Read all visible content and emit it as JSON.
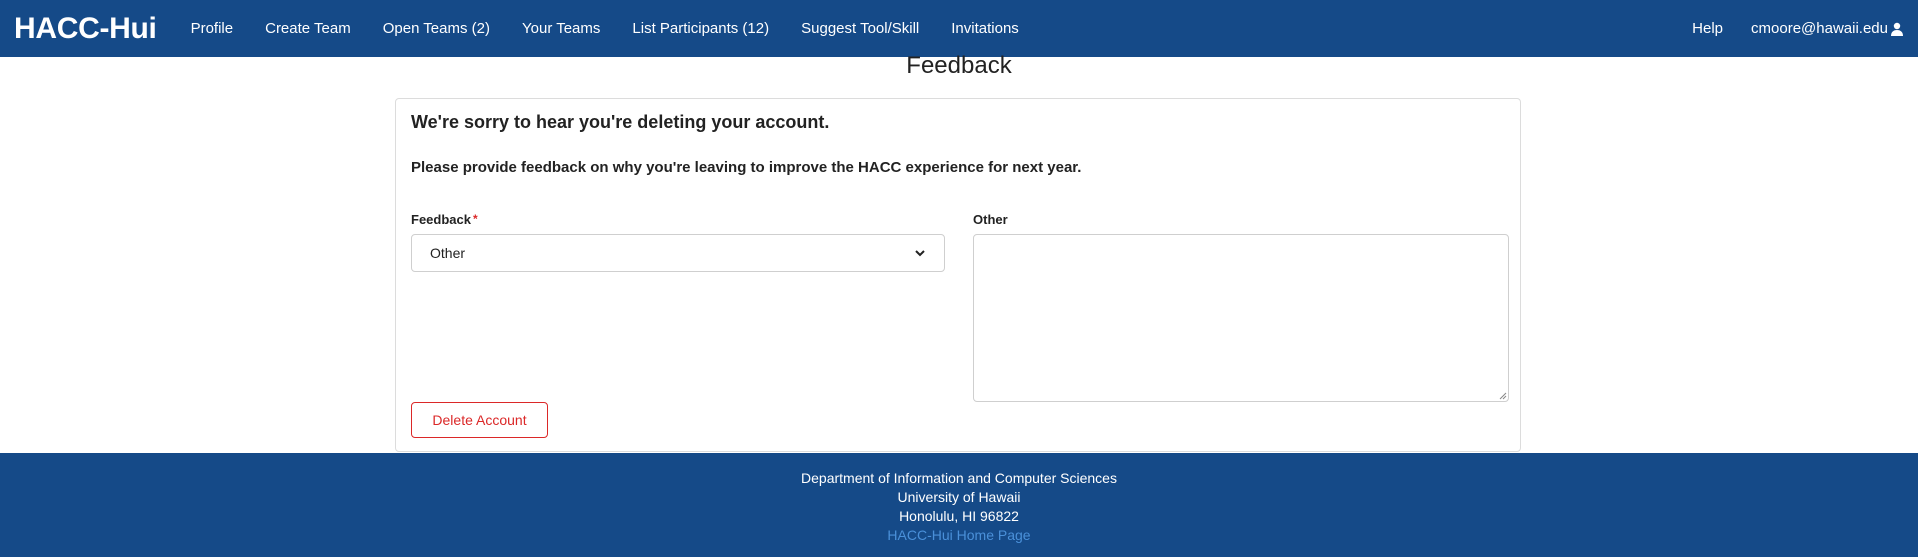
{
  "navbar": {
    "brand": "HACC-Hui",
    "links": [
      "Profile",
      "Create Team",
      "Open Teams (2)",
      "Your Teams",
      "List Participants (12)",
      "Suggest Tool/Skill",
      "Invitations"
    ],
    "help": "Help",
    "user": "cmoore@hawaii.edu",
    "user_icon": "user-icon"
  },
  "page": {
    "title": "Feedback"
  },
  "card": {
    "heading": "We're sorry to hear you're deleting your account.",
    "subheading": "Please provide feedback on why you're leaving to improve the HACC experience for next year.",
    "feedback_label": "Feedback",
    "required_mark": "*",
    "feedback_value": "Other",
    "other_label": "Other",
    "other_value": "",
    "delete_button": "Delete Account"
  },
  "footer": {
    "line1": "Department of Information and Computer Sciences",
    "line2": "University of Hawaii",
    "line3": "Honolulu, HI 96822",
    "link": "HACC-Hui Home Page"
  },
  "colors": {
    "navbar": "#154a88",
    "danger": "#db2828",
    "footer_link": "#4a90d9"
  }
}
